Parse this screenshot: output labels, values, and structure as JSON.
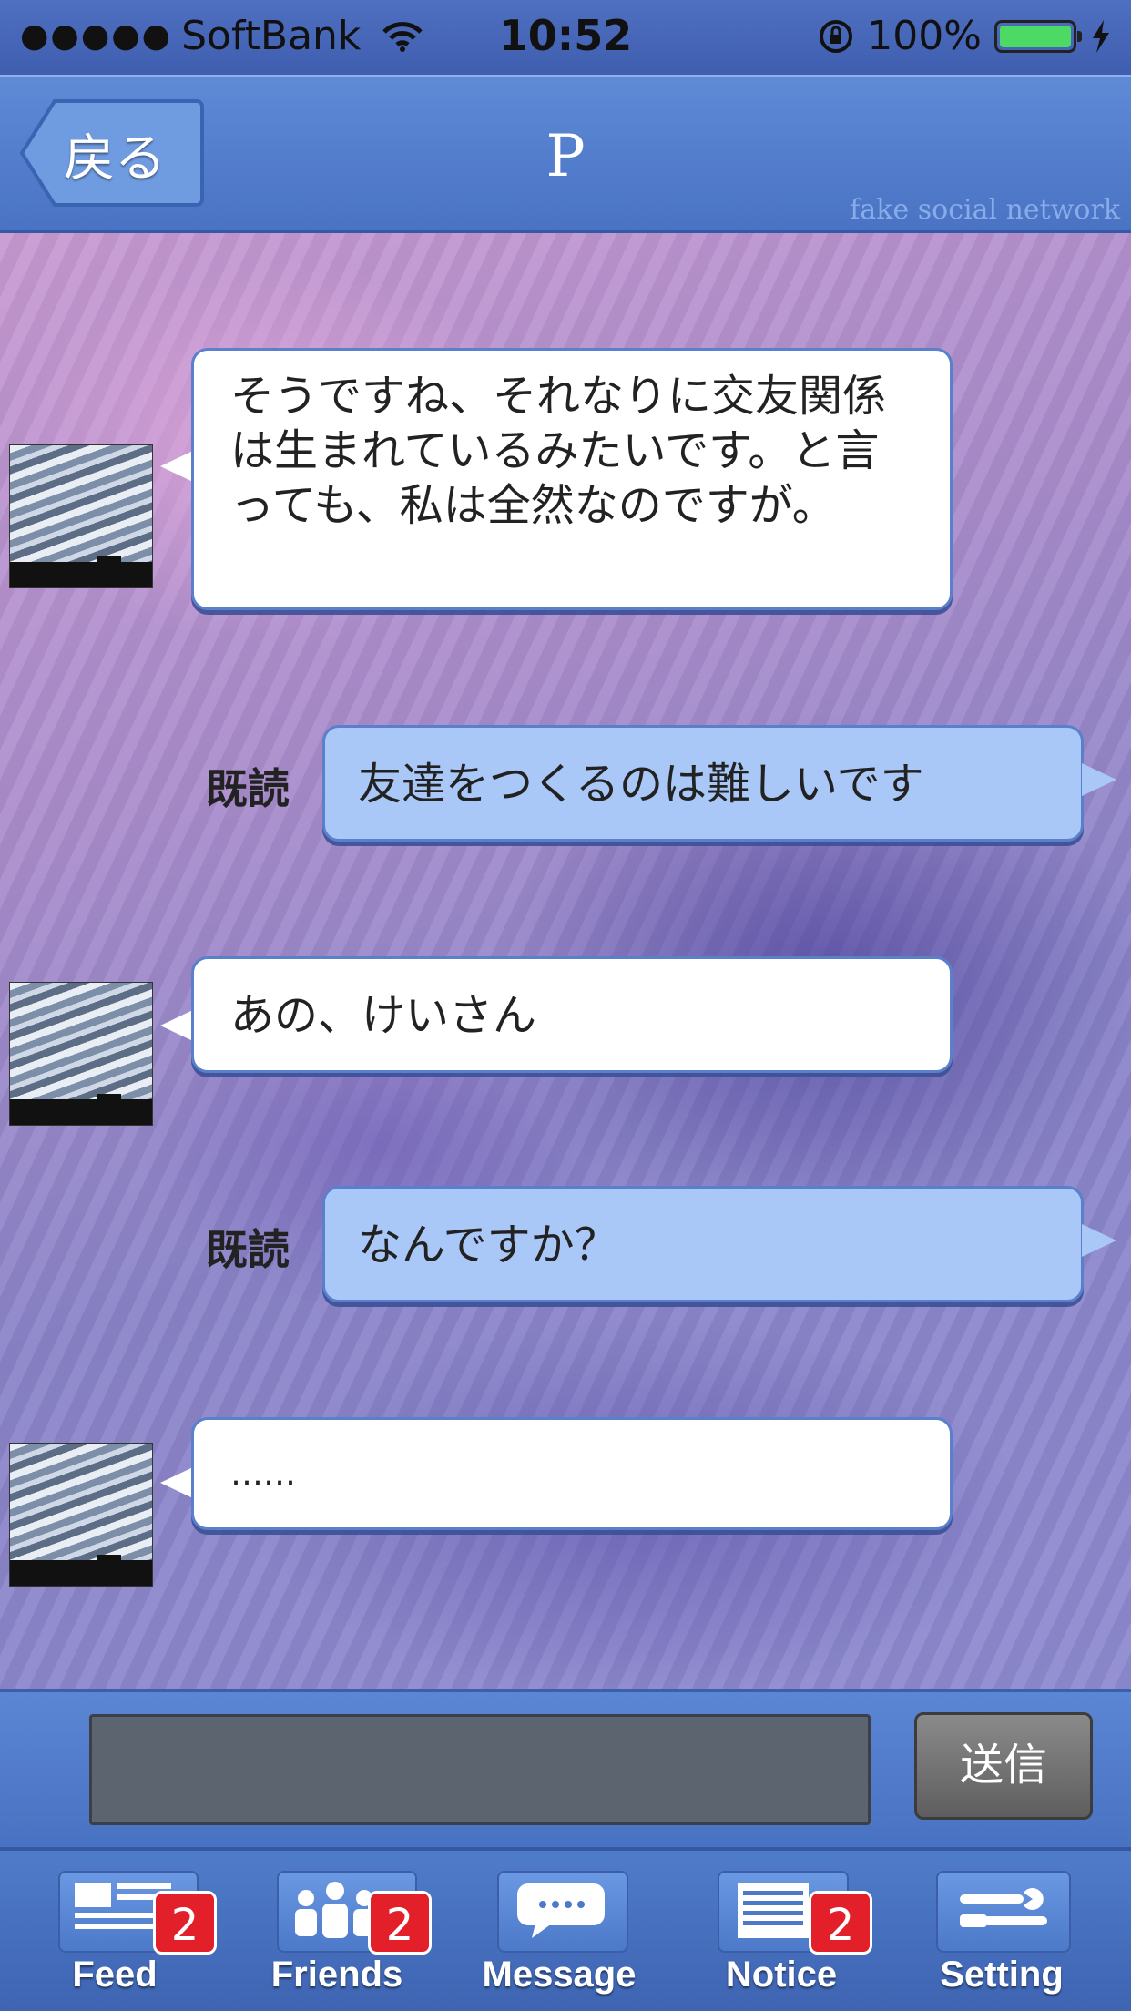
{
  "status_bar": {
    "signal": "●●●●●",
    "carrier": "SoftBank",
    "time": "10:52",
    "battery_percent": "100%",
    "battery_level": 1.0,
    "battery_color": "#4cd964"
  },
  "nav": {
    "back_label": "戻る",
    "title": "P",
    "watermark": "fake social network"
  },
  "messages": [
    {
      "direction": "in",
      "text": "そうですね、それなりに交友関係は生まれているみたいです。と言っても、私は全然なのですが。"
    },
    {
      "direction": "out",
      "read": "既読",
      "text": "友達をつくるのは難しいです"
    },
    {
      "direction": "in",
      "text": "あの、けいさん"
    },
    {
      "direction": "out",
      "read": "既読",
      "text": "なんですか？"
    },
    {
      "direction": "in",
      "text": "……"
    }
  ],
  "composer": {
    "value": "",
    "send_label": "送信"
  },
  "tabs": [
    {
      "label": "Feed",
      "icon": "feed-icon",
      "badge": "2"
    },
    {
      "label": "Friends",
      "icon": "friends-icon",
      "badge": "2"
    },
    {
      "label": "Message",
      "icon": "message-icon",
      "badge": ""
    },
    {
      "label": "Notice",
      "icon": "notice-icon",
      "badge": "2"
    },
    {
      "label": "Setting",
      "icon": "setting-icon",
      "badge": ""
    }
  ],
  "colors": {
    "accent": "#4a73c4",
    "bubble_out": "#a9c7f7",
    "badge": "#e3202a"
  }
}
